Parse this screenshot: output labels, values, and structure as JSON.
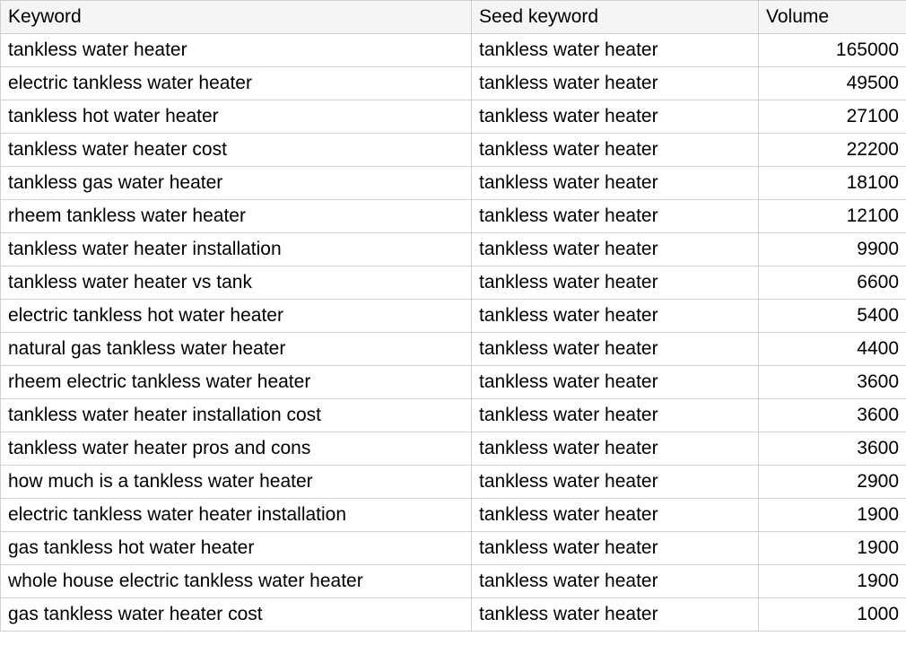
{
  "table": {
    "headers": {
      "keyword": "Keyword",
      "seed": "Seed keyword",
      "volume": "Volume"
    },
    "rows": [
      {
        "keyword": "tankless water heater",
        "seed": "tankless water heater",
        "volume": "165000"
      },
      {
        "keyword": "electric tankless water heater",
        "seed": "tankless water heater",
        "volume": "49500"
      },
      {
        "keyword": "tankless hot water heater",
        "seed": "tankless water heater",
        "volume": "27100"
      },
      {
        "keyword": "tankless water heater cost",
        "seed": "tankless water heater",
        "volume": "22200"
      },
      {
        "keyword": "tankless gas water heater",
        "seed": "tankless water heater",
        "volume": "18100"
      },
      {
        "keyword": "rheem tankless water heater",
        "seed": "tankless water heater",
        "volume": "12100"
      },
      {
        "keyword": "tankless water heater installation",
        "seed": "tankless water heater",
        "volume": "9900"
      },
      {
        "keyword": "tankless water heater vs tank",
        "seed": "tankless water heater",
        "volume": "6600"
      },
      {
        "keyword": "electric tankless hot water heater",
        "seed": "tankless water heater",
        "volume": "5400"
      },
      {
        "keyword": "natural gas tankless water heater",
        "seed": "tankless water heater",
        "volume": "4400"
      },
      {
        "keyword": "rheem electric tankless water heater",
        "seed": "tankless water heater",
        "volume": "3600"
      },
      {
        "keyword": "tankless water heater installation cost",
        "seed": "tankless water heater",
        "volume": "3600"
      },
      {
        "keyword": "tankless water heater pros and cons",
        "seed": "tankless water heater",
        "volume": "3600"
      },
      {
        "keyword": "how much is a tankless water heater",
        "seed": "tankless water heater",
        "volume": "2900"
      },
      {
        "keyword": "electric tankless water heater installation",
        "seed": "tankless water heater",
        "volume": "1900"
      },
      {
        "keyword": "gas tankless hot water heater",
        "seed": "tankless water heater",
        "volume": "1900"
      },
      {
        "keyword": "whole house electric tankless water heater",
        "seed": "tankless water heater",
        "volume": "1900"
      },
      {
        "keyword": "gas tankless water heater cost",
        "seed": "tankless water heater",
        "volume": "1000"
      }
    ]
  }
}
